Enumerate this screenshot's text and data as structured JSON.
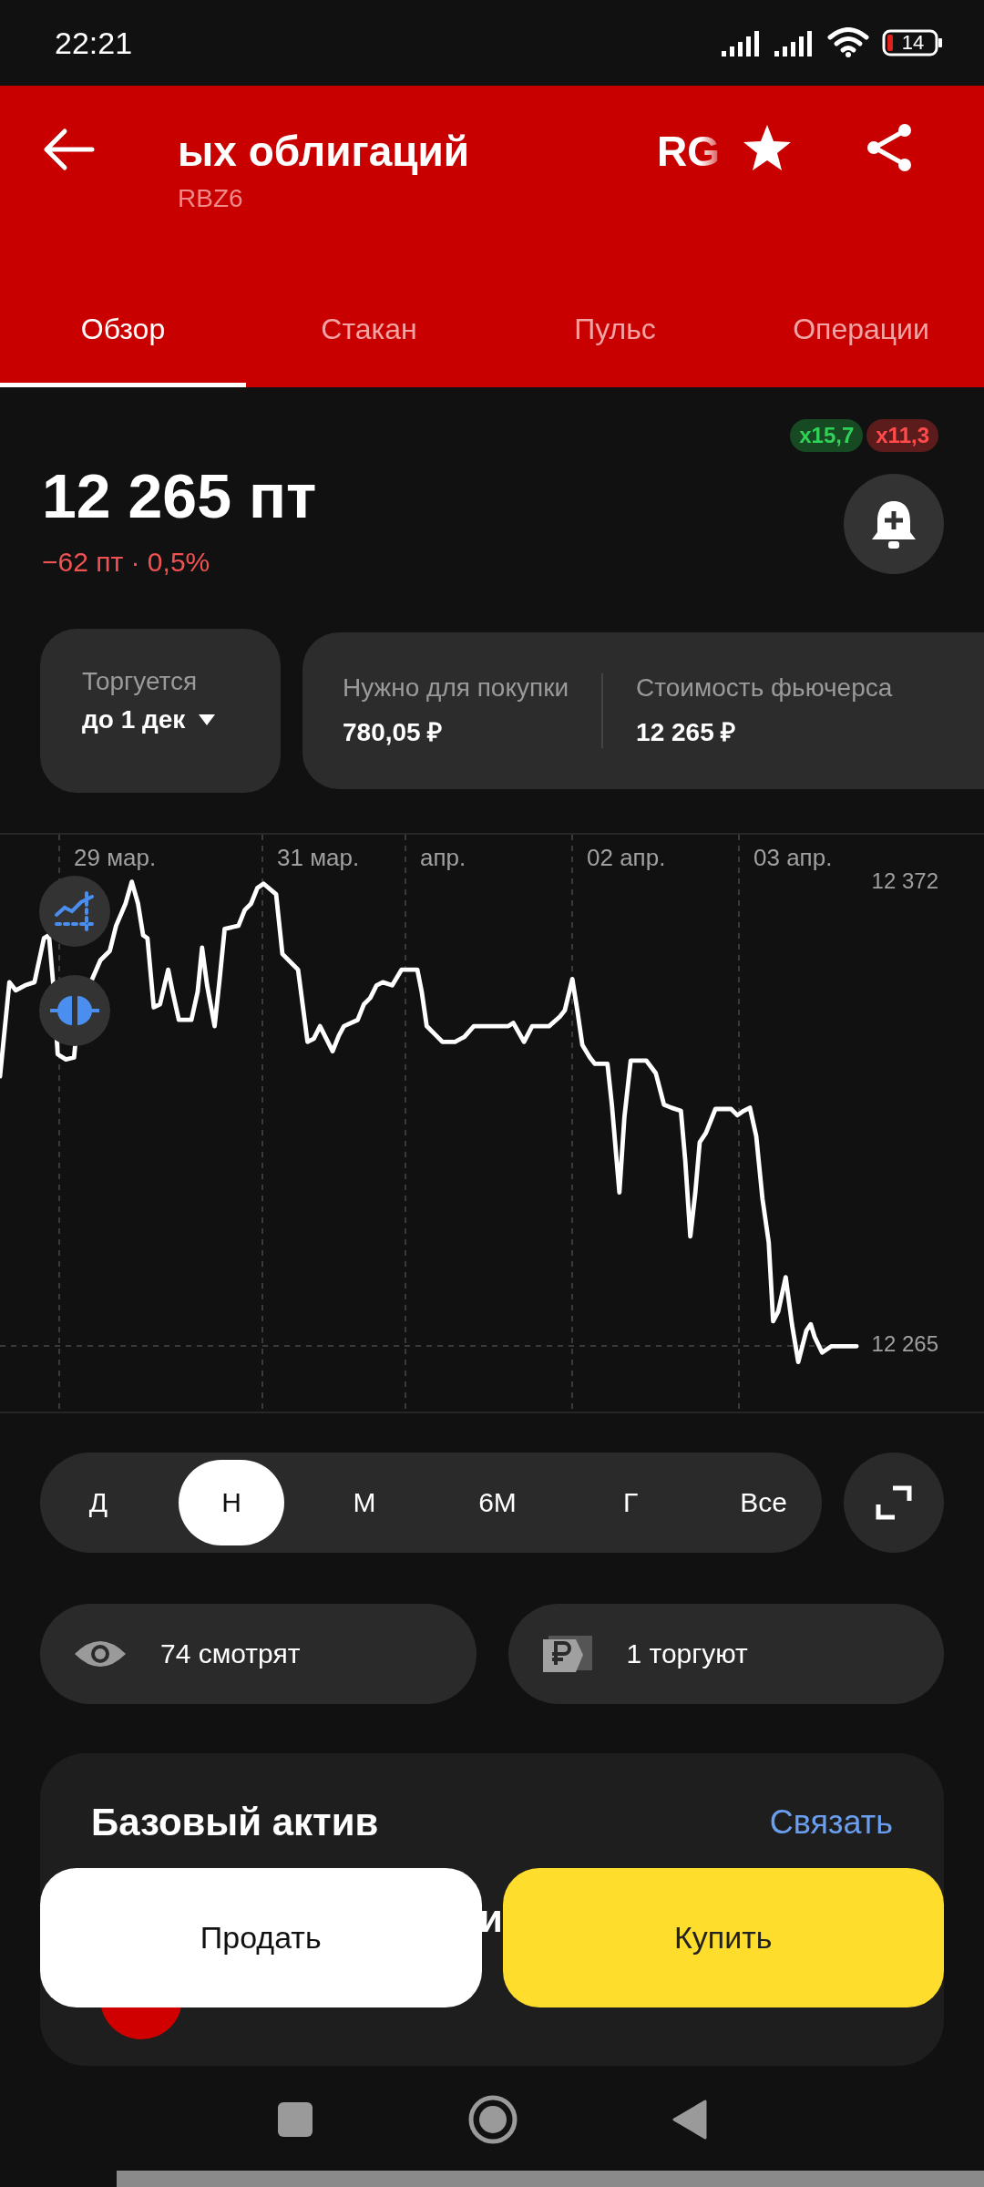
{
  "status_bar": {
    "time": "22:21",
    "battery": "14"
  },
  "header": {
    "title": "ых облигаций",
    "title_tail": "RG",
    "subtitle": "RBZ6",
    "favorite": true
  },
  "tabs": [
    {
      "label": "Обзор",
      "selected": true
    },
    {
      "label": "Стакан",
      "selected": false
    },
    {
      "label": "Пульс",
      "selected": false
    },
    {
      "label": "Операции",
      "selected": false
    }
  ],
  "quote": {
    "price": "12 265 пт",
    "change": {
      "text": "−62 пт · 0,5%",
      "kind": "down"
    },
    "badges": [
      {
        "label": "x15,7",
        "kind": "long"
      },
      {
        "label": "x11,3",
        "kind": "short"
      }
    ]
  },
  "info": {
    "trading": {
      "label": "Торгуется",
      "value": "до 1 дек"
    },
    "metrics": [
      {
        "label": "Нужно для покупки",
        "value": "780,05 ₽"
      },
      {
        "label": "Стоимость фьючерса",
        "value": "12 265 ₽"
      }
    ]
  },
  "chart": {
    "date_labels": [
      "29 мар.",
      "31 мар.",
      "апр.",
      "02 апр.",
      "03 апр."
    ],
    "high_label": "12 372",
    "last_label": "12 265"
  },
  "ranges": [
    {
      "label": "Д",
      "selected": false
    },
    {
      "label": "Н",
      "selected": true
    },
    {
      "label": "М",
      "selected": false
    },
    {
      "label": "6М",
      "selected": false
    },
    {
      "label": "Г",
      "selected": false
    },
    {
      "label": "Все",
      "selected": false
    }
  ],
  "stats": [
    {
      "kind": "watchers",
      "text": "74 смотрят"
    },
    {
      "kind": "traders",
      "text": "1 торгуют"
    }
  ],
  "underlying": {
    "title": "Базовый актив",
    "link": "Связать",
    "item_fragment": "и"
  },
  "actions": [
    {
      "label": "Продать",
      "kind": "sell"
    },
    {
      "label": "Купить",
      "kind": "buy"
    }
  ]
}
